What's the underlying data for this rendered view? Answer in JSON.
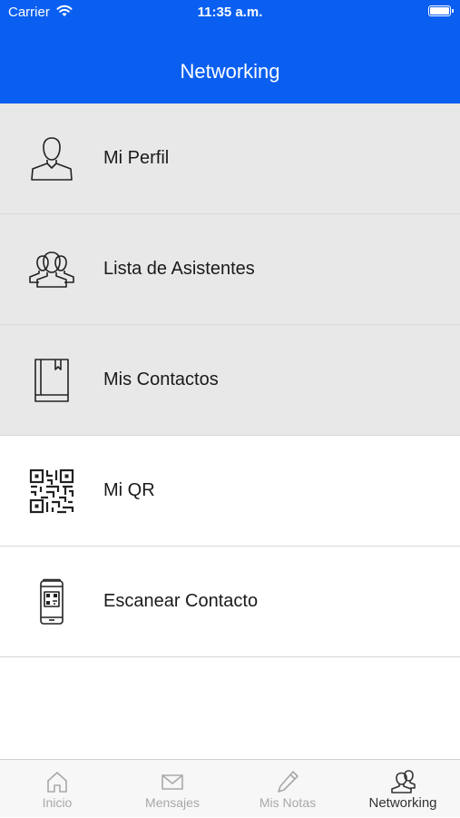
{
  "status_bar": {
    "carrier": "Carrier",
    "time": "11:35 a.m."
  },
  "header": {
    "title": "Networking"
  },
  "menu": [
    {
      "label": "Mi Perfil",
      "icon": "user-icon"
    },
    {
      "label": "Lista de Asistentes",
      "icon": "users-icon"
    },
    {
      "label": "Mis Contactos",
      "icon": "contacts-book-icon"
    },
    {
      "label": "Mi QR",
      "icon": "qr-code-icon"
    },
    {
      "label": "Escanear Contacto",
      "icon": "phone-scan-icon"
    }
  ],
  "tabs": [
    {
      "label": "Inicio",
      "icon": "home-icon",
      "active": false
    },
    {
      "label": "Mensajes",
      "icon": "mail-icon",
      "active": false
    },
    {
      "label": "Mis Notas",
      "icon": "pencil-icon",
      "active": false
    },
    {
      "label": "Networking",
      "icon": "users-icon",
      "active": true
    }
  ],
  "colors": {
    "header_bg": "#0a5ff0",
    "row_grey": "#e8e8e8",
    "tab_active": "#333333",
    "tab_inactive": "#a8a8a8"
  }
}
